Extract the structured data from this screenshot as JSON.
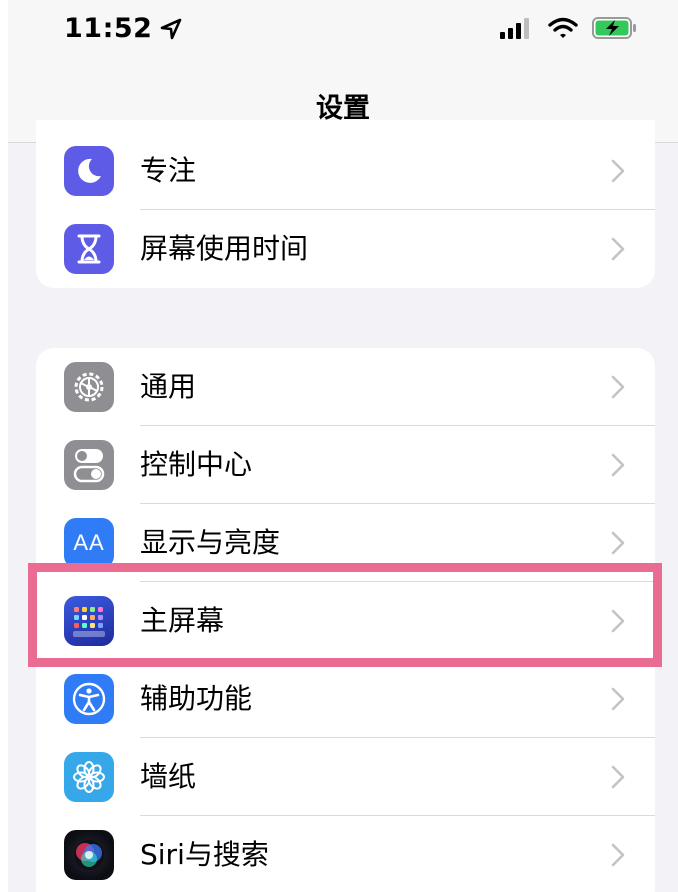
{
  "status_bar": {
    "time": "11:52",
    "icons": [
      "location-arrow-icon",
      "cellular-signal-icon",
      "wifi-icon",
      "battery-charging-icon"
    ]
  },
  "nav": {
    "title": "设置"
  },
  "group1": {
    "items": [
      {
        "label": "专注",
        "icon": "moon-icon",
        "color": "#5e5ce6"
      },
      {
        "label": "屏幕使用时间",
        "icon": "hourglass-icon",
        "color": "#5e5ce6"
      }
    ]
  },
  "group2": {
    "items": [
      {
        "label": "通用",
        "icon": "gear-icon",
        "color": "#8e8e93"
      },
      {
        "label": "控制中心",
        "icon": "toggles-icon",
        "color": "#8e8e93"
      },
      {
        "label": "显示与亮度",
        "icon": "text-size-icon",
        "icon_text": "AA",
        "color": "#2f7cf6"
      },
      {
        "label": "主屏幕",
        "icon": "home-screen-grid-icon",
        "color": "#2d3fc9",
        "highlighted": true
      },
      {
        "label": "辅助功能",
        "icon": "accessibility-icon",
        "color": "#2f7cf6"
      },
      {
        "label": "墙纸",
        "icon": "flower-icon",
        "color": "#36a7e8"
      },
      {
        "label": "Siri与搜索",
        "icon": "siri-icon",
        "color": "#1c1c28"
      }
    ]
  },
  "colors": {
    "highlight_border": "#ea6c92",
    "background": "#f2f2f7",
    "chevron": "#c4c4c8"
  }
}
